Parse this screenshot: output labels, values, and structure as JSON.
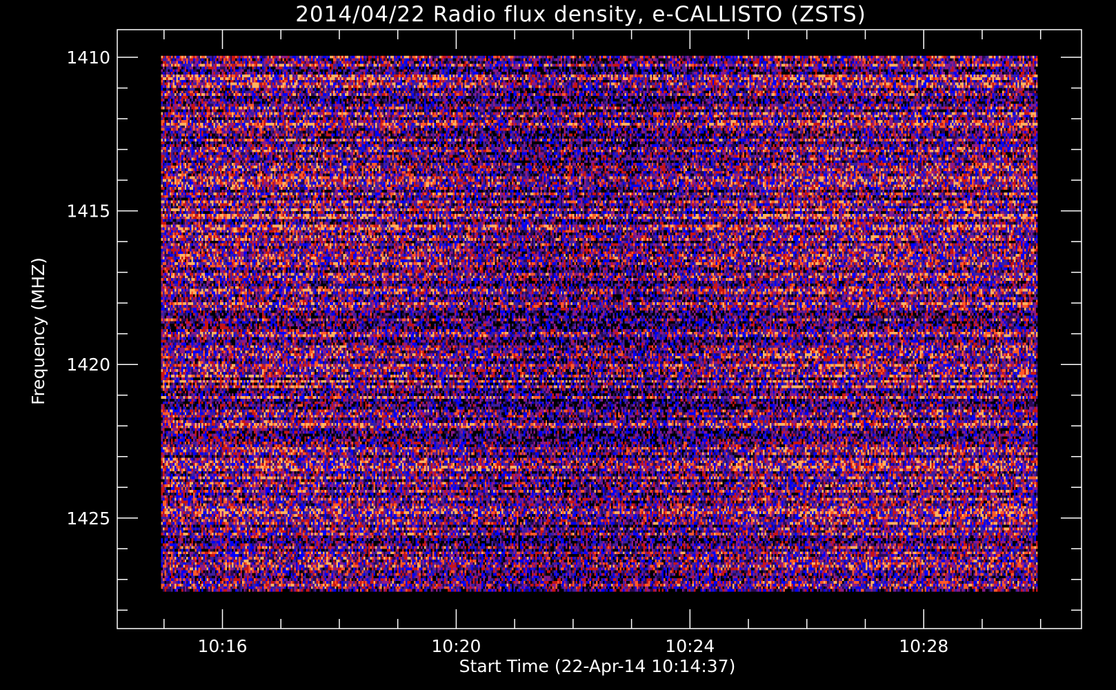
{
  "chart_data": {
    "type": "heatmap",
    "title": "2014/04/22  Radio flux density, e-CALLISTO (ZSTS)",
    "xlabel": "Start Time (22-Apr-14 10:14:37)",
    "ylabel": "Frequency (MHZ)",
    "x_unit": "UT time (minutes after 10:00)",
    "xlim": [
      14.2,
      30.7
    ],
    "x_data_range": [
      14.95,
      29.95
    ],
    "ylim": [
      1428.6,
      1409.1
    ],
    "y_data_range": [
      1409.95,
      1427.4
    ],
    "y_axis_inverted": true,
    "x_ticks": [
      {
        "value": 16,
        "label": "10:16"
      },
      {
        "value": 20,
        "label": "10:20"
      },
      {
        "value": 24,
        "label": "10:24"
      },
      {
        "value": 28,
        "label": "10:28"
      }
    ],
    "y_ticks": [
      {
        "value": 1410,
        "label": "1410"
      },
      {
        "value": 1415,
        "label": "1415"
      },
      {
        "value": 1420,
        "label": "1420"
      },
      {
        "value": 1425,
        "label": "1425"
      }
    ],
    "colormap": [
      "#000000",
      "#2a0a55",
      "#3d1fa0",
      "#0000ff",
      "#8a1a8a",
      "#c81414",
      "#ff5a28",
      "#ffb060"
    ],
    "grid": false,
    "legend": "none",
    "background_color": "#000000",
    "axis_color": "#ffffff"
  }
}
